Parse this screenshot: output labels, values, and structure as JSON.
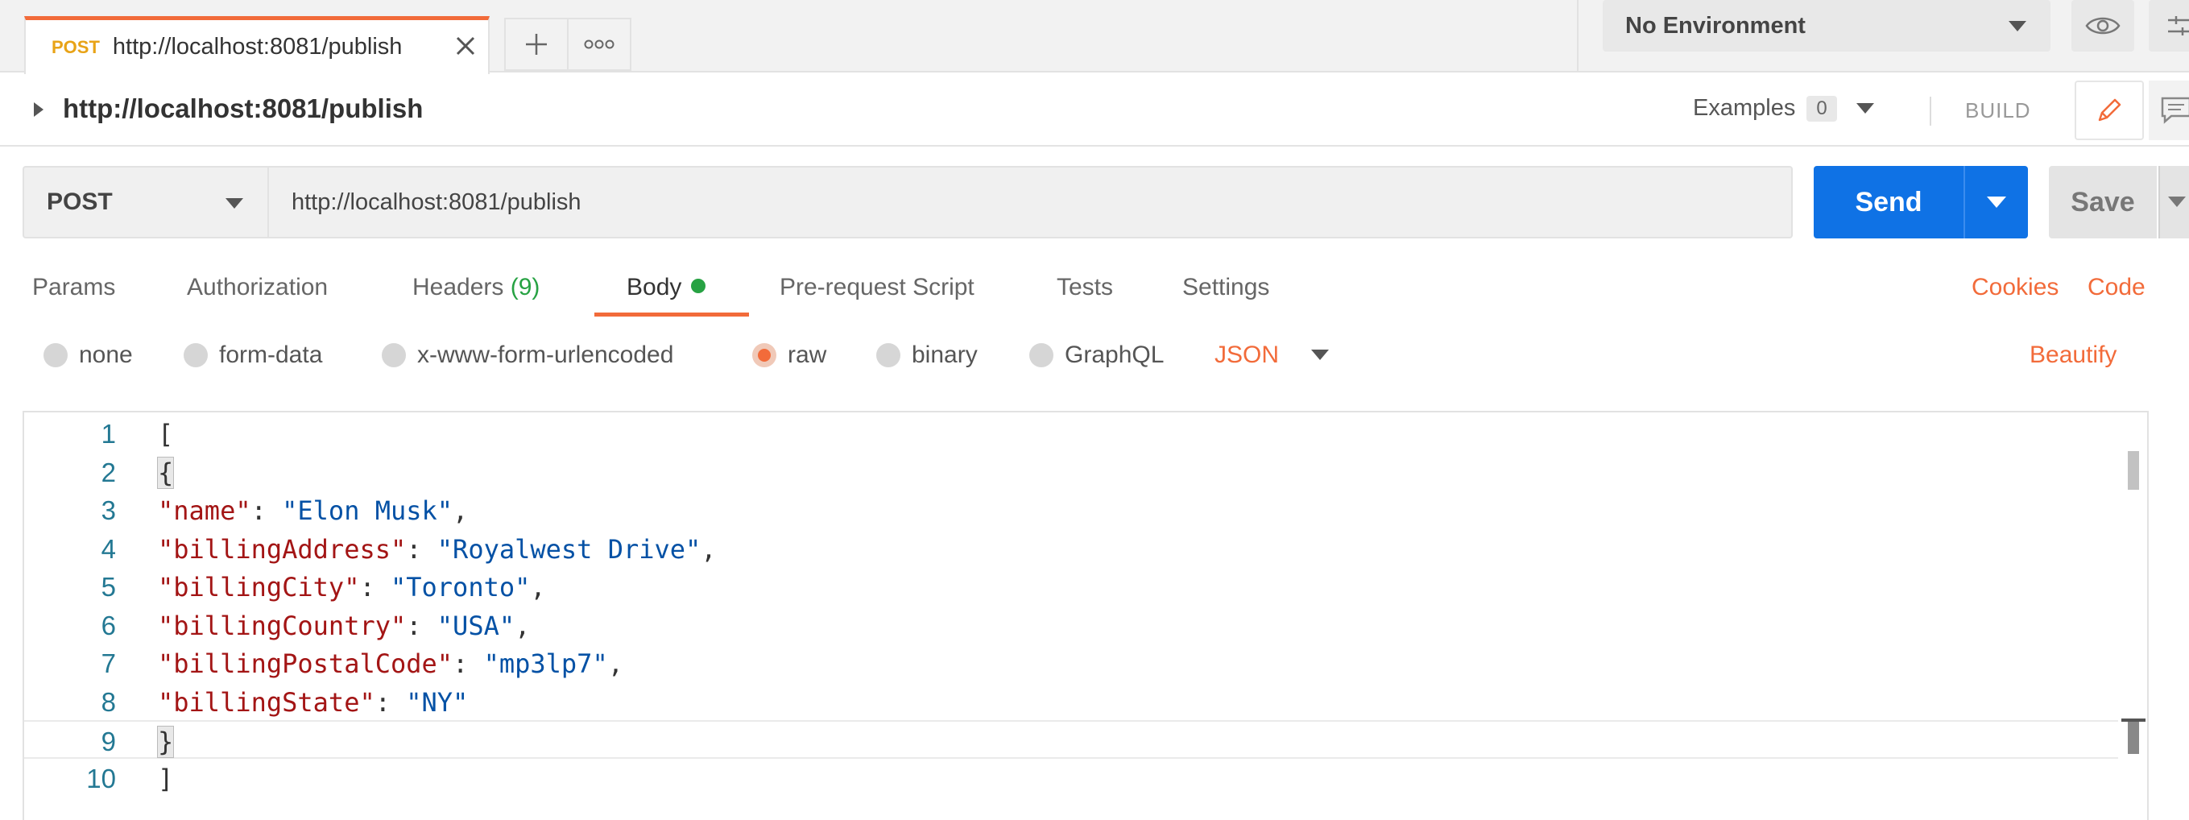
{
  "tabs": {
    "active": {
      "method": "POST",
      "title": "http://localhost:8081/publish"
    }
  },
  "environment": {
    "selected": "No Environment"
  },
  "request_title": "http://localhost:8081/publish",
  "examples": {
    "label": "Examples",
    "count": "0"
  },
  "build_label": "BUILD",
  "request": {
    "method": "POST",
    "url": "http://localhost:8081/publish",
    "send_label": "Send",
    "save_label": "Save"
  },
  "request_tabs": {
    "params": "Params",
    "authorization": "Authorization",
    "headers": "Headers",
    "headers_count": "(9)",
    "body": "Body",
    "pre_request": "Pre-request Script",
    "tests": "Tests",
    "settings": "Settings",
    "cookies": "Cookies",
    "code": "Code"
  },
  "body_types": {
    "none": "none",
    "form_data": "form-data",
    "urlencoded": "x-www-form-urlencoded",
    "raw": "raw",
    "binary": "binary",
    "graphql": "GraphQL",
    "selected": "raw",
    "format": "JSON",
    "beautify": "Beautify"
  },
  "editor": {
    "lines": [
      {
        "num": "1",
        "open": "["
      },
      {
        "num": "2",
        "open": "{"
      },
      {
        "num": "3",
        "key": "\"name\"",
        "sep": ": ",
        "value": "\"Elon Musk\"",
        "end": ","
      },
      {
        "num": "4",
        "key": "\"billingAddress\"",
        "sep": ": ",
        "value": "\"Royalwest Drive\"",
        "end": ","
      },
      {
        "num": "5",
        "key": "\"billingCity\"",
        "sep": ": ",
        "value": "\"Toronto\"",
        "end": ","
      },
      {
        "num": "6",
        "key": "\"billingCountry\"",
        "sep": ": ",
        "value": "\"USA\"",
        "end": ","
      },
      {
        "num": "7",
        "key": "\"billingPostalCode\"",
        "sep": ": ",
        "value": "\"mp3lp7\"",
        "end": ","
      },
      {
        "num": "8",
        "key": "\"billingState\"",
        "sep": ": ",
        "value": "\"NY\"",
        "end": ""
      },
      {
        "num": "9",
        "open": "}"
      },
      {
        "num": "10",
        "open": "]"
      }
    ]
  }
}
